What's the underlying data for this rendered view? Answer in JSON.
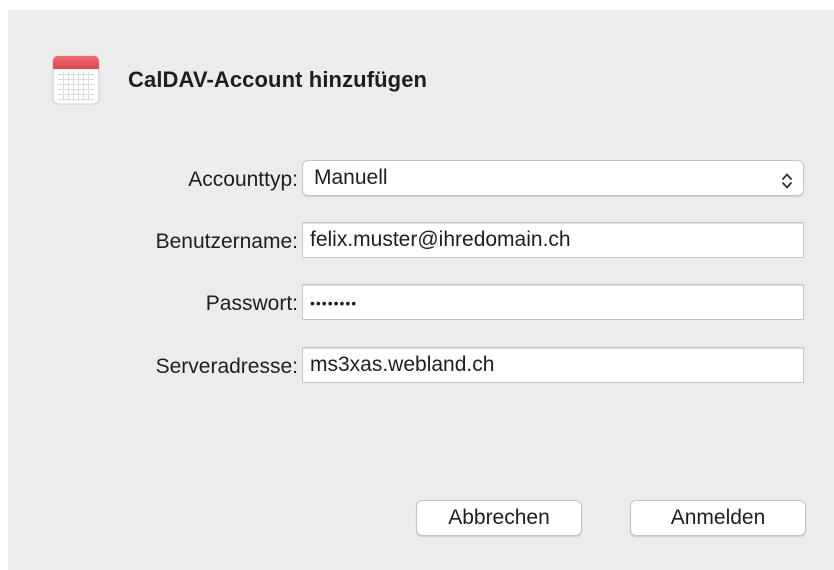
{
  "dialog": {
    "title": "CalDAV-Account hinzufügen",
    "icon": "calendar-icon"
  },
  "form": {
    "account_type": {
      "label": "Accounttyp:",
      "value": "Manuell"
    },
    "username": {
      "label": "Benutzername:",
      "value": "felix.muster@ihredomain.ch"
    },
    "password": {
      "label": "Passwort:",
      "value": "••••••••"
    },
    "server": {
      "label": "Serveradresse:",
      "value": "ms3xas.webland.ch"
    }
  },
  "buttons": {
    "cancel_label": "Abbrechen",
    "login_label": "Anmelden"
  },
  "colors": {
    "dialog_background": "#ececec",
    "calendar_red": "#e5535b"
  }
}
